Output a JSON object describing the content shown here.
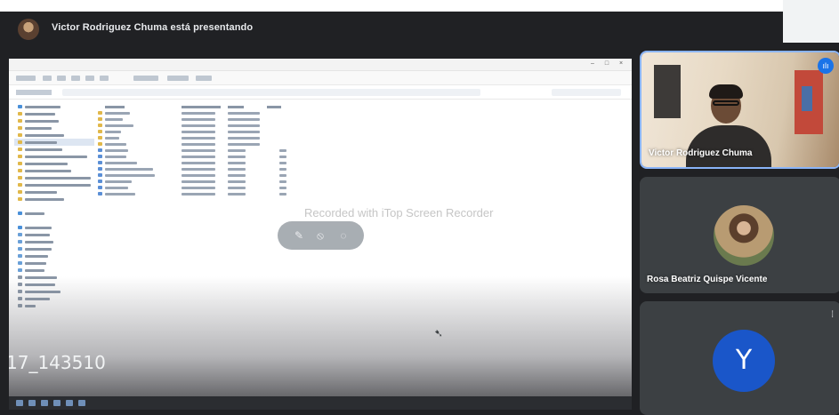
{
  "header": {
    "presenting_text": "Victor Rodriguez Chuma está presentando"
  },
  "shared_screen": {
    "watermark": "Recorded with iTop Screen Recorder",
    "recording_name": "17_143510"
  },
  "participants": [
    {
      "name": "Victor Rodriguez Chuma",
      "speaking": true
    },
    {
      "name": "Rosa Beatriz Quispe Vicente"
    },
    {
      "initial": "Y"
    }
  ],
  "icons": {
    "speaking": "audio-wave-icon",
    "mic_off": "mic-off-icon",
    "pin": "pin-icon"
  },
  "colors": {
    "background": "#202124",
    "speaking_border": "#8ab4f8",
    "avatar_y": "#1a56c9"
  }
}
